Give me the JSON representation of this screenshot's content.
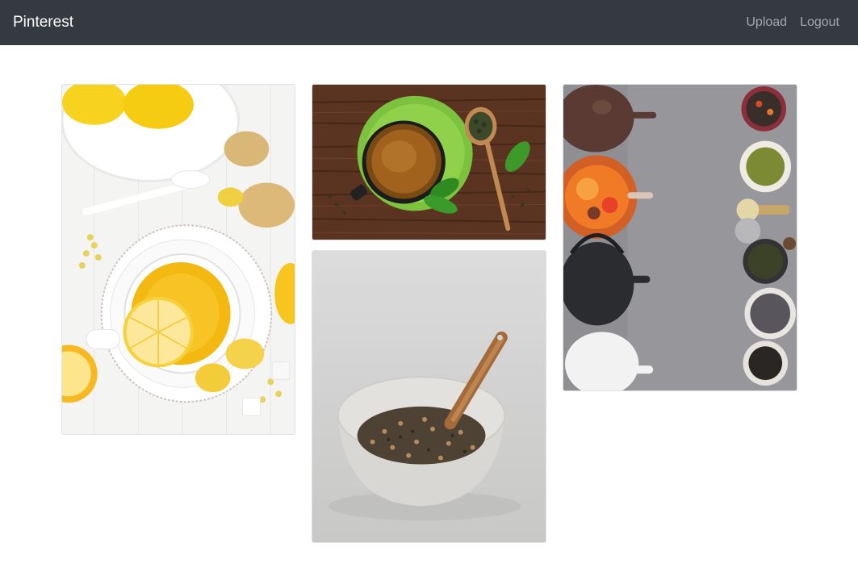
{
  "navbar": {
    "brand": "Pinterest",
    "links": [
      {
        "label": "Upload"
      },
      {
        "label": "Logout"
      }
    ],
    "background": "#343a40"
  },
  "pins": [
    {
      "subject": "lemon-tea-cup"
    },
    {
      "subject": "green-tea-cup"
    },
    {
      "subject": "tea-leaves-bowl"
    },
    {
      "subject": "teapots-and-spices"
    }
  ]
}
